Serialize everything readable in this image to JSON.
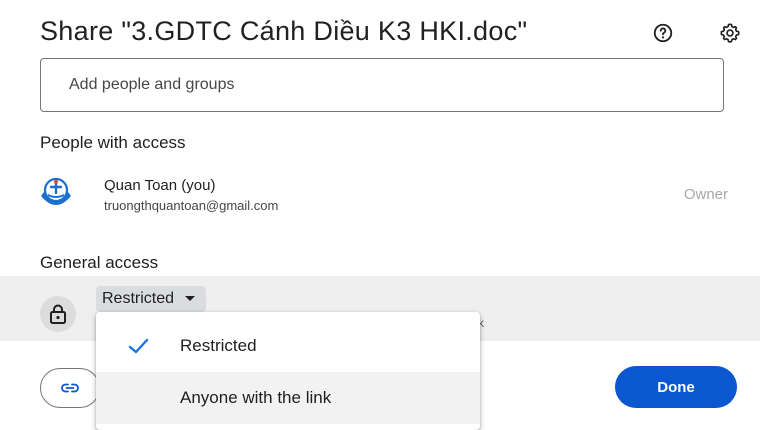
{
  "dialog": {
    "title": "Share \"3.GDTC Cánh Diều K3 HKI.doc\"",
    "help_icon": "help-circle-icon",
    "settings_icon": "gear-icon"
  },
  "search": {
    "placeholder": "Add people and groups"
  },
  "people_section": {
    "heading": "People with access",
    "people": [
      {
        "name": "Quan Toan (you)",
        "email": "truongthquantoan@gmail.com",
        "role": "Owner",
        "avatar_icon": "school-emblem-avatar"
      }
    ]
  },
  "general_access": {
    "heading": "General access",
    "lock_icon": "lock-icon",
    "selected": "Restricted",
    "description_partial": "k",
    "options": [
      {
        "label": "Restricted",
        "checked": true
      },
      {
        "label": "Anyone with the link",
        "checked": false
      }
    ]
  },
  "footer": {
    "copy_link_icon": "link-icon",
    "done_label": "Done"
  },
  "colors": {
    "primary": "#0b57d0",
    "check": "#1a73e8",
    "band": "#efefef"
  }
}
